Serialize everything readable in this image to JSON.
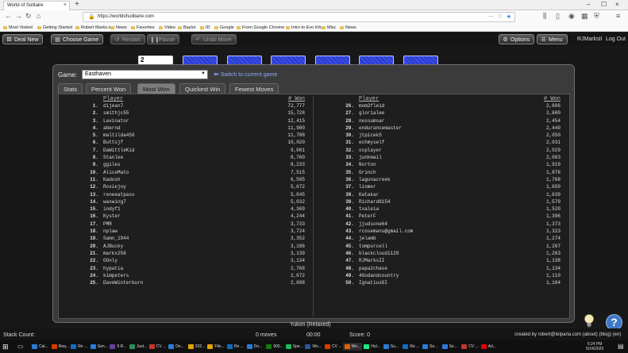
{
  "browser": {
    "tab_title": "World of Solitaire",
    "url": "https://worldofsolitaire.com",
    "bookmarks": [
      "Most Visited",
      "Getting Started",
      "Robert Marks.org",
      "News",
      "Favorites",
      "Video",
      "Baylor",
      "ID",
      "Google",
      "From Google Chrome",
      "Intro to Evo Info",
      "Misc",
      "News"
    ]
  },
  "toolbar": {
    "deal_new": "Deal New",
    "choose_game": "Choose Game",
    "restart": "Restart",
    "pause": "Pause",
    "undo_move": "Undo Move",
    "options": "Options",
    "menu": "Menu",
    "user": "RJMarksII",
    "logout": "Log Out"
  },
  "cards": {
    "face_up_rank": "2"
  },
  "dialog": {
    "game_label": "Game:",
    "game_value": "Easthaven",
    "switch_link": "Switch to current game",
    "tabs": [
      "Stats",
      "Percent Won",
      "Most Won",
      "Quickest Win",
      "Fewest Moves"
    ],
    "active_tab": "Most Won",
    "col_player": "Player",
    "col_won": "# Won",
    "rows_left": [
      {
        "rank": "1.",
        "name": "dijean7",
        "won": "72,777"
      },
      {
        "rank": "2.",
        "name": "smithjc55",
        "won": "15,728"
      },
      {
        "rank": "3.",
        "name": "Lavinator",
        "won": "12,415"
      },
      {
        "rank": "4.",
        "name": "abernd",
        "won": "11,900"
      },
      {
        "rank": "5.",
        "name": "maltilda456",
        "won": "11,788"
      },
      {
        "rank": "6.",
        "name": "Buttsjf",
        "won": "10,020"
      },
      {
        "rank": "7.",
        "name": "DaWittleKid",
        "won": "9,001"
      },
      {
        "rank": "8.",
        "name": "Stanlee",
        "won": "8,760"
      },
      {
        "rank": "9.",
        "name": "ggiles",
        "won": "8,233"
      },
      {
        "rank": "10.",
        "name": "AliceMato",
        "won": "7,515"
      },
      {
        "rank": "11.",
        "name": "Kadosh",
        "won": "6,505"
      },
      {
        "rank": "12.",
        "name": "Roxiejoy",
        "won": "5,672"
      },
      {
        "rank": "13.",
        "name": "reneeatpaso",
        "won": "5,045"
      },
      {
        "rank": "14.",
        "name": "waxwing7",
        "won": "5,032"
      },
      {
        "rank": "15.",
        "name": "indyf1",
        "won": "4,369"
      },
      {
        "rank": "16.",
        "name": "Kyster",
        "won": "4,244"
      },
      {
        "rank": "17.",
        "name": "PMR",
        "won": "3,733"
      },
      {
        "rank": "18.",
        "name": "nplaw",
        "won": "3,724"
      },
      {
        "rank": "19.",
        "name": "Samn_1944",
        "won": "3,352"
      },
      {
        "rank": "20.",
        "name": "AJBucky",
        "won": "3,186"
      },
      {
        "rank": "21.",
        "name": "markx256",
        "won": "3,139"
      },
      {
        "rank": "22.",
        "name": "GOnly",
        "won": "3,134"
      },
      {
        "rank": "23.",
        "name": "hypatia",
        "won": "2,768"
      },
      {
        "rank": "24.",
        "name": "kimpeters",
        "won": "2,672"
      },
      {
        "rank": "25.",
        "name": "DaveWinterburn",
        "won": "2,608"
      }
    ],
    "rows_right": [
      {
        "rank": "26.",
        "name": "mom2fleid",
        "won": "2,606"
      },
      {
        "rank": "27.",
        "name": "glorialee",
        "won": "2,600"
      },
      {
        "rank": "28.",
        "name": "nessumsar",
        "won": "2,454"
      },
      {
        "rank": "29.",
        "name": "endurancemaster",
        "won": "2,440"
      },
      {
        "rank": "30.",
        "name": "jtpicek5",
        "won": "2,050"
      },
      {
        "rank": "31.",
        "name": "echmyself",
        "won": "2,031"
      },
      {
        "rank": "32.",
        "name": "ocplayer",
        "won": "2,029"
      },
      {
        "rank": "33.",
        "name": "junkmail",
        "won": "2,003"
      },
      {
        "rank": "34.",
        "name": "Norton",
        "won": "1,919"
      },
      {
        "rank": "35.",
        "name": "Grinch",
        "won": "1,876"
      },
      {
        "rank": "36.",
        "name": "lagunacreek",
        "won": "1,768"
      },
      {
        "rank": "37.",
        "name": "linmer",
        "won": "1,650"
      },
      {
        "rank": "38.",
        "name": "Katakar",
        "won": "1,639"
      },
      {
        "rank": "39.",
        "name": "Richard6154",
        "won": "1,579"
      },
      {
        "rank": "40.",
        "name": "txaleia",
        "won": "1,520"
      },
      {
        "rank": "41.",
        "name": "PeterF",
        "won": "1,396"
      },
      {
        "rank": "42.",
        "name": "jjudsone64",
        "won": "1,373"
      },
      {
        "rank": "43.",
        "name": "rcosemans@gmail.com",
        "won": "1,323"
      },
      {
        "rank": "44.",
        "name": "jelamb",
        "won": "1,274"
      },
      {
        "rank": "45.",
        "name": "tompurcell",
        "won": "1,267"
      },
      {
        "rank": "46.",
        "name": "blackcloud1129",
        "won": "1,263"
      },
      {
        "rank": "47.",
        "name": "RJMarksII",
        "won": "1,138"
      },
      {
        "rank": "48.",
        "name": "papa2chase",
        "won": "1,134"
      },
      {
        "rank": "49.",
        "name": "4Godandcountry",
        "won": "1,110"
      },
      {
        "rank": "50.",
        "name": "IgnatiusGI",
        "won": "1,104"
      }
    ]
  },
  "status": {
    "game_name": "Yukon (Relaxed)",
    "stack_count": "Stack Count:",
    "moves": "0 moves",
    "time": "00:00",
    "score": "Score: 0",
    "credit": "created by robert@telparia.com (about) (blog) (en)"
  },
  "taskbar": {
    "items": [
      "Cal...",
      "Req...",
      "Re ...",
      "Sen...",
      "9 R...",
      "Just...",
      "CV ...",
      "Do...",
      "202...",
      "File...",
      "Re ...",
      "Do...",
      "900...",
      "Spe...",
      "Wo...",
      "CV ...",
      "Wo...",
      "Hul...",
      "Su...",
      "Re ...",
      "Se...",
      "Se...",
      "CV ...",
      "Ad..."
    ],
    "time": "5:24 PM",
    "date": "5/24/2020"
  },
  "colors": {
    "accent_link": "#8aa8ff",
    "card_back": "#2a3cc9",
    "help_button": "#3f78c7"
  }
}
